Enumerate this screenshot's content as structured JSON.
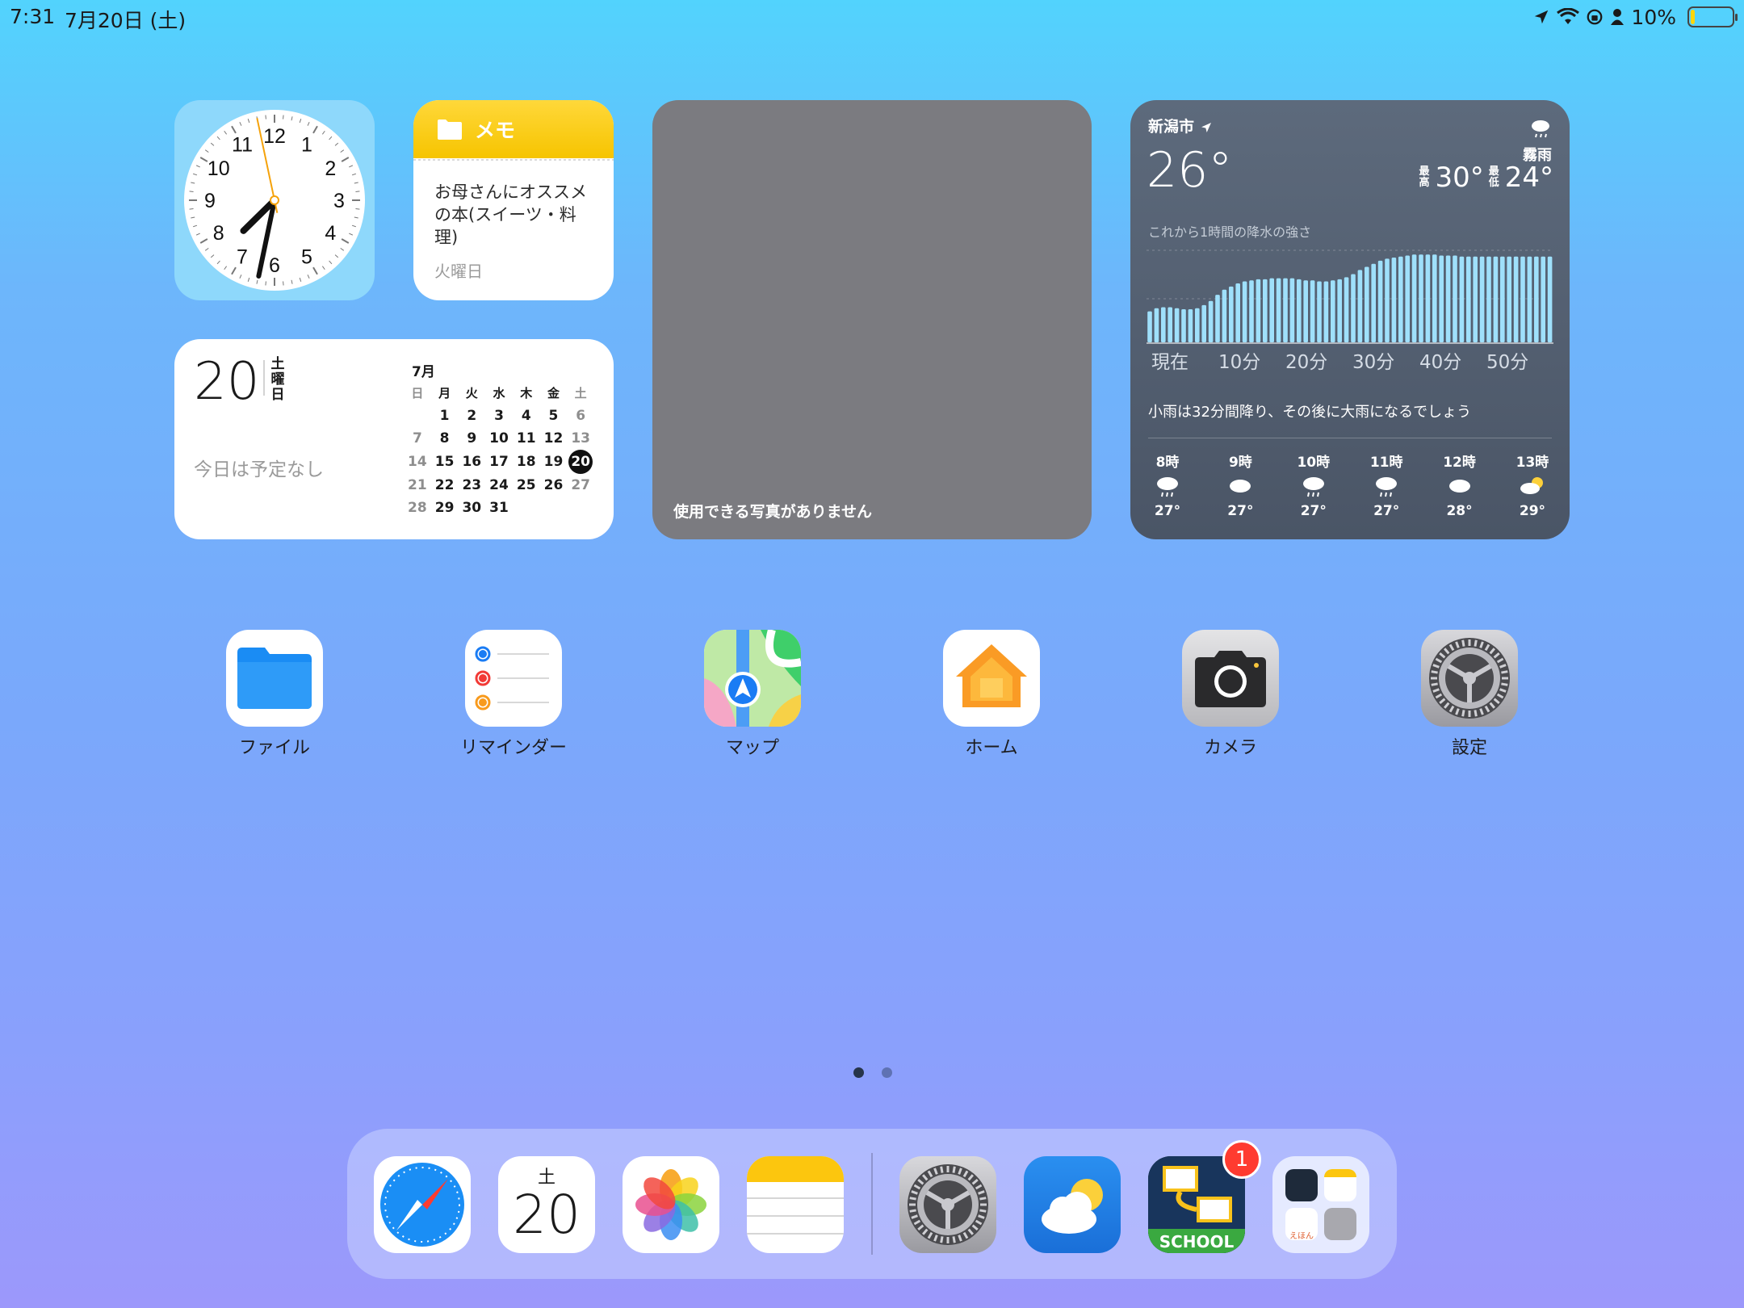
{
  "status": {
    "time": "7:31",
    "date": "7月20日 (土)",
    "battery": "10%",
    "battery_level": 0.1
  },
  "clock": {
    "numbers": [
      "12",
      "1",
      "2",
      "3",
      "4",
      "5",
      "6",
      "7",
      "8",
      "9",
      "10",
      "11"
    ],
    "hour": 7,
    "minute": 31,
    "second": 58
  },
  "notes_widget": {
    "title": "メモ",
    "text": "お母さんにオススメの本(スイーツ・料理)",
    "day": "火曜日"
  },
  "calendar_widget": {
    "day_number": "20",
    "weekday_vertical": "土曜日",
    "no_events": "今日は予定なし",
    "month": "7月",
    "headers": [
      "日",
      "月",
      "火",
      "水",
      "木",
      "金",
      "土"
    ],
    "rows": [
      [
        "",
        "1",
        "2",
        "3",
        "4",
        "5",
        "6"
      ],
      [
        "7",
        "8",
        "9",
        "10",
        "11",
        "12",
        "13"
      ],
      [
        "14",
        "15",
        "16",
        "17",
        "18",
        "19",
        "20"
      ],
      [
        "21",
        "22",
        "23",
        "24",
        "25",
        "26",
        "27"
      ],
      [
        "28",
        "29",
        "30",
        "31",
        "",
        "",
        ""
      ]
    ],
    "today": "20"
  },
  "photos_widget": {
    "message": "使用できる写真がありません"
  },
  "weather_widget": {
    "city": "新潟市",
    "temp": "26°",
    "condition": "霧雨",
    "high_label": "最高",
    "high": "30°",
    "low_label": "最低",
    "low": "24°",
    "rain_title": "これから1時間の降水の強さ",
    "chart_data": {
      "type": "bar",
      "x_labels": [
        "現在",
        "10分",
        "20分",
        "30分",
        "40分",
        "50分"
      ],
      "values": [
        0.3,
        0.33,
        0.34,
        0.34,
        0.33,
        0.32,
        0.32,
        0.33,
        0.36,
        0.4,
        0.46,
        0.51,
        0.54,
        0.57,
        0.59,
        0.6,
        0.61,
        0.61,
        0.62,
        0.62,
        0.62,
        0.62,
        0.61,
        0.6,
        0.6,
        0.59,
        0.59,
        0.6,
        0.61,
        0.63,
        0.66,
        0.7,
        0.73,
        0.76,
        0.79,
        0.81,
        0.82,
        0.83,
        0.84,
        0.85,
        0.85,
        0.85,
        0.85,
        0.84,
        0.84,
        0.84,
        0.83,
        0.83,
        0.83,
        0.83,
        0.83,
        0.83,
        0.83,
        0.83,
        0.83,
        0.83,
        0.83,
        0.83,
        0.83,
        0.83
      ]
    },
    "summary": "小雨は32分間降り、その後に大雨になるでしょう",
    "hourly": [
      {
        "hour": "8時",
        "temp": "27°",
        "icon": "rain-cloud-icon"
      },
      {
        "hour": "9時",
        "temp": "27°",
        "icon": "cloud-icon"
      },
      {
        "hour": "10時",
        "temp": "27°",
        "icon": "rain-cloud-icon"
      },
      {
        "hour": "11時",
        "temp": "27°",
        "icon": "rain-cloud-icon"
      },
      {
        "hour": "12時",
        "temp": "28°",
        "icon": "cloud-icon"
      },
      {
        "hour": "13時",
        "temp": "29°",
        "icon": "partly-sunny-icon"
      }
    ]
  },
  "apps": [
    {
      "label": "ファイル",
      "icon": "files-icon"
    },
    {
      "label": "リマインダー",
      "icon": "reminders-icon"
    },
    {
      "label": "マップ",
      "icon": "maps-icon"
    },
    {
      "label": "ホーム",
      "icon": "home-icon"
    },
    {
      "label": "カメラ",
      "icon": "camera-icon"
    },
    {
      "label": "設定",
      "icon": "settings-icon"
    }
  ],
  "dock": {
    "calendar_weekday": "土",
    "calendar_day": "20",
    "school_label": "SCHOOL",
    "badge": "1",
    "folder_mini_label": "えほん"
  },
  "colors": {
    "notes_yellow": "#f6c400",
    "weather_bar": "#9fe0fb",
    "badge_red": "#ff3b30"
  }
}
